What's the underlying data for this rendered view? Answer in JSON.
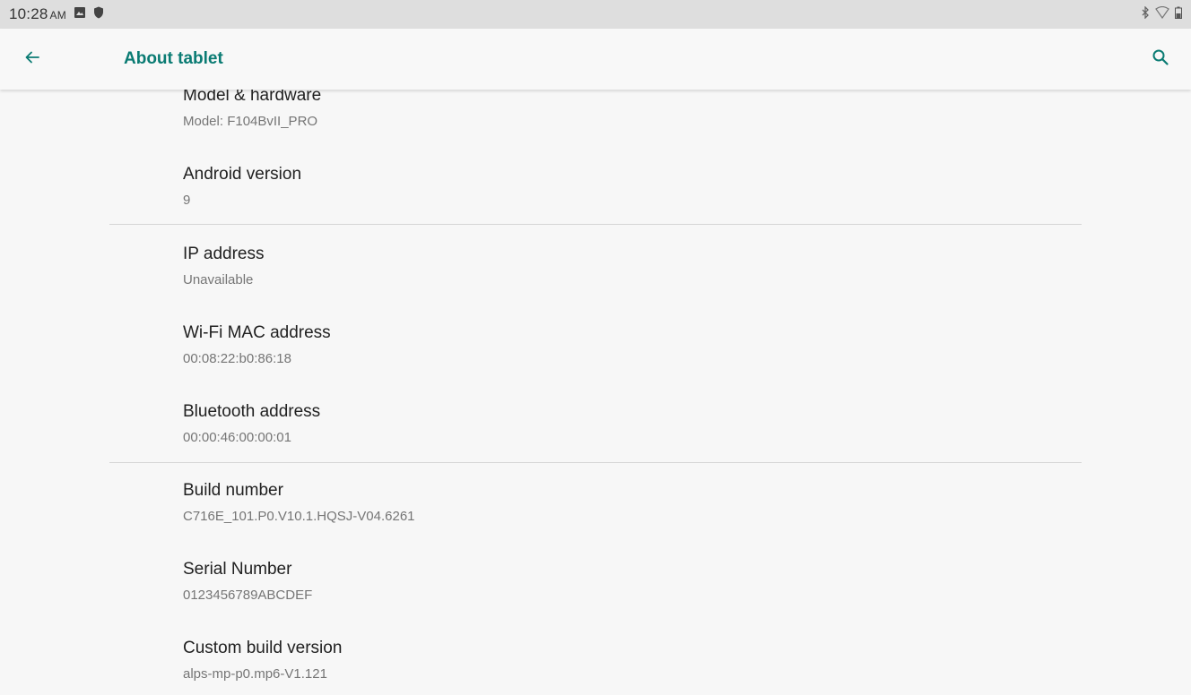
{
  "status_bar": {
    "time": "10:28",
    "ampm": "AM",
    "left_icons": [
      "image-icon",
      "shield-icon"
    ],
    "right_icons": [
      "bluetooth-icon",
      "wifi-icon",
      "battery-icon"
    ]
  },
  "app_bar": {
    "title": "About tablet",
    "back_icon": "arrow-back-icon",
    "search_icon": "search-icon",
    "accent_color": "#0a7b73"
  },
  "items": [
    {
      "title": "Model & hardware",
      "summary": "Model: F104BvII_PRO"
    },
    {
      "title": "Android version",
      "summary": "9"
    },
    {
      "title": "IP address",
      "summary": "Unavailable"
    },
    {
      "title": "Wi-Fi MAC address",
      "summary": "00:08:22:b0:86:18"
    },
    {
      "title": "Bluetooth address",
      "summary": "00:00:46:00:00:01"
    },
    {
      "title": "Build number",
      "summary": "C716E_101.P0.V10.1.HQSJ-V04.6261"
    },
    {
      "title": "Serial Number",
      "summary": "0123456789ABCDEF"
    },
    {
      "title": "Custom build version",
      "summary": "alps-mp-p0.mp6-V1.121"
    }
  ]
}
